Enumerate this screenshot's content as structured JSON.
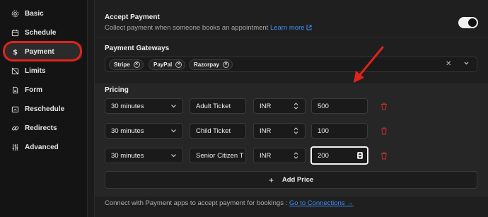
{
  "sidebar": {
    "items": [
      {
        "label": "Basic",
        "icon": "gear-icon"
      },
      {
        "label": "Schedule",
        "icon": "calendar-icon"
      },
      {
        "label": "Payment",
        "icon": "dollar-icon"
      },
      {
        "label": "Limits",
        "icon": "calendar-off-icon"
      },
      {
        "label": "Form",
        "icon": "form-icon"
      },
      {
        "label": "Reschedule",
        "icon": "calendar-reschedule-icon"
      },
      {
        "label": "Redirects",
        "icon": "link-icon"
      },
      {
        "label": "Advanced",
        "icon": "sliders-icon"
      }
    ],
    "active": "Payment"
  },
  "accept_payment": {
    "title": "Accept Payment",
    "description": "Collect payment when someone books an appointment",
    "link_text": "Learn more",
    "enabled": true
  },
  "gateways": {
    "title": "Payment Gateways",
    "chips": [
      "Stripe",
      "PayPal",
      "Razorpay"
    ]
  },
  "pricing": {
    "title": "Pricing",
    "rows": [
      {
        "duration": "30 minutes",
        "name": "Adult Ticket",
        "currency": "INR",
        "price": "500"
      },
      {
        "duration": "30 minutes",
        "name": "Child Ticket",
        "currency": "INR",
        "price": "100"
      },
      {
        "duration": "30 minutes",
        "name": "Senior Citizen T",
        "currency": "INR",
        "price": "200"
      }
    ],
    "add_label": "Add Price"
  },
  "footer": {
    "text": "Connect with Payment apps to accept payment for bookings :",
    "link_text": "Go to Connections →"
  },
  "colors": {
    "accent": "#3f8ef5",
    "highlight": "#e0231a",
    "danger": "#c8302a"
  }
}
